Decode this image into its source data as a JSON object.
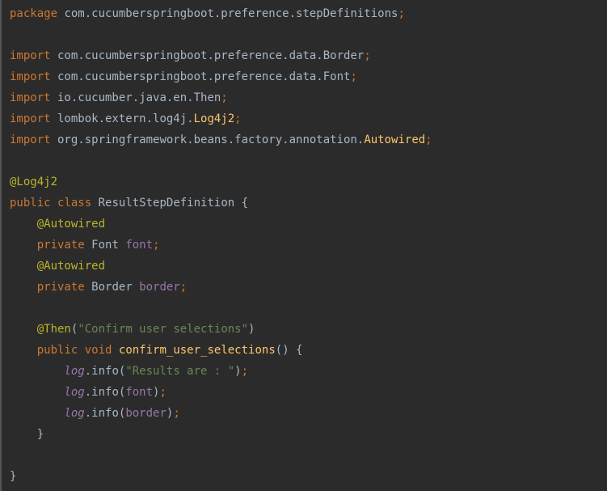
{
  "code": {
    "package_keyword": "package",
    "package_path": " com.cucumberspringboot.preference.stepDefinitions",
    "import_keyword": "import",
    "import1": " com.cucumberspringboot.preference.data.Border",
    "import2": " com.cucumberspringboot.preference.data.Font",
    "import3": " io.cucumber.java.en.Then",
    "import4_prefix": " lombok.extern.log4j.",
    "import4_class": "Log4j2",
    "import5_prefix": " org.springframework.beans.factory.annotation.",
    "import5_class": "Autowired",
    "annotation_log4j2": "@Log4j2",
    "public_keyword": "public",
    "class_keyword": "class",
    "class_name": "ResultStepDefinition",
    "annotation_autowired": "@Autowired",
    "private_keyword": "private",
    "type_font": "Font",
    "field_font": "font",
    "type_border": "Border",
    "field_border": "border",
    "annotation_then": "@Then",
    "then_string": "\"Confirm user selections\"",
    "void_keyword": "void",
    "method_name": "confirm_user_selections",
    "log_var": "log",
    "info_method": ".info(",
    "results_string": "\"Results are : \"",
    "semicolon": ";",
    "space": " ",
    "open_brace": "{",
    "close_brace": "}",
    "open_paren": "(",
    "close_paren": ")",
    "empty_parens": "()"
  }
}
